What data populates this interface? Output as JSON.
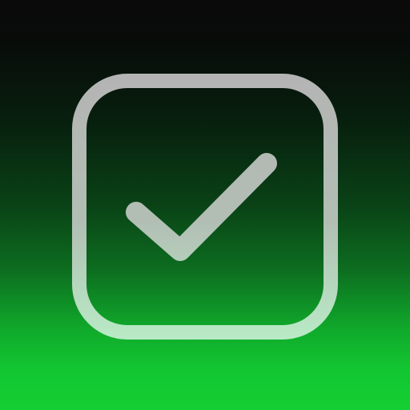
{
  "icon": {
    "name": "checkbox-checked-icon",
    "state": "checked",
    "colors": {
      "background_top": "#0a0a0a",
      "background_bottom": "#14cf33",
      "stroke_top": "#b4b4b4",
      "stroke_bottom": "#b9ebc6"
    }
  }
}
